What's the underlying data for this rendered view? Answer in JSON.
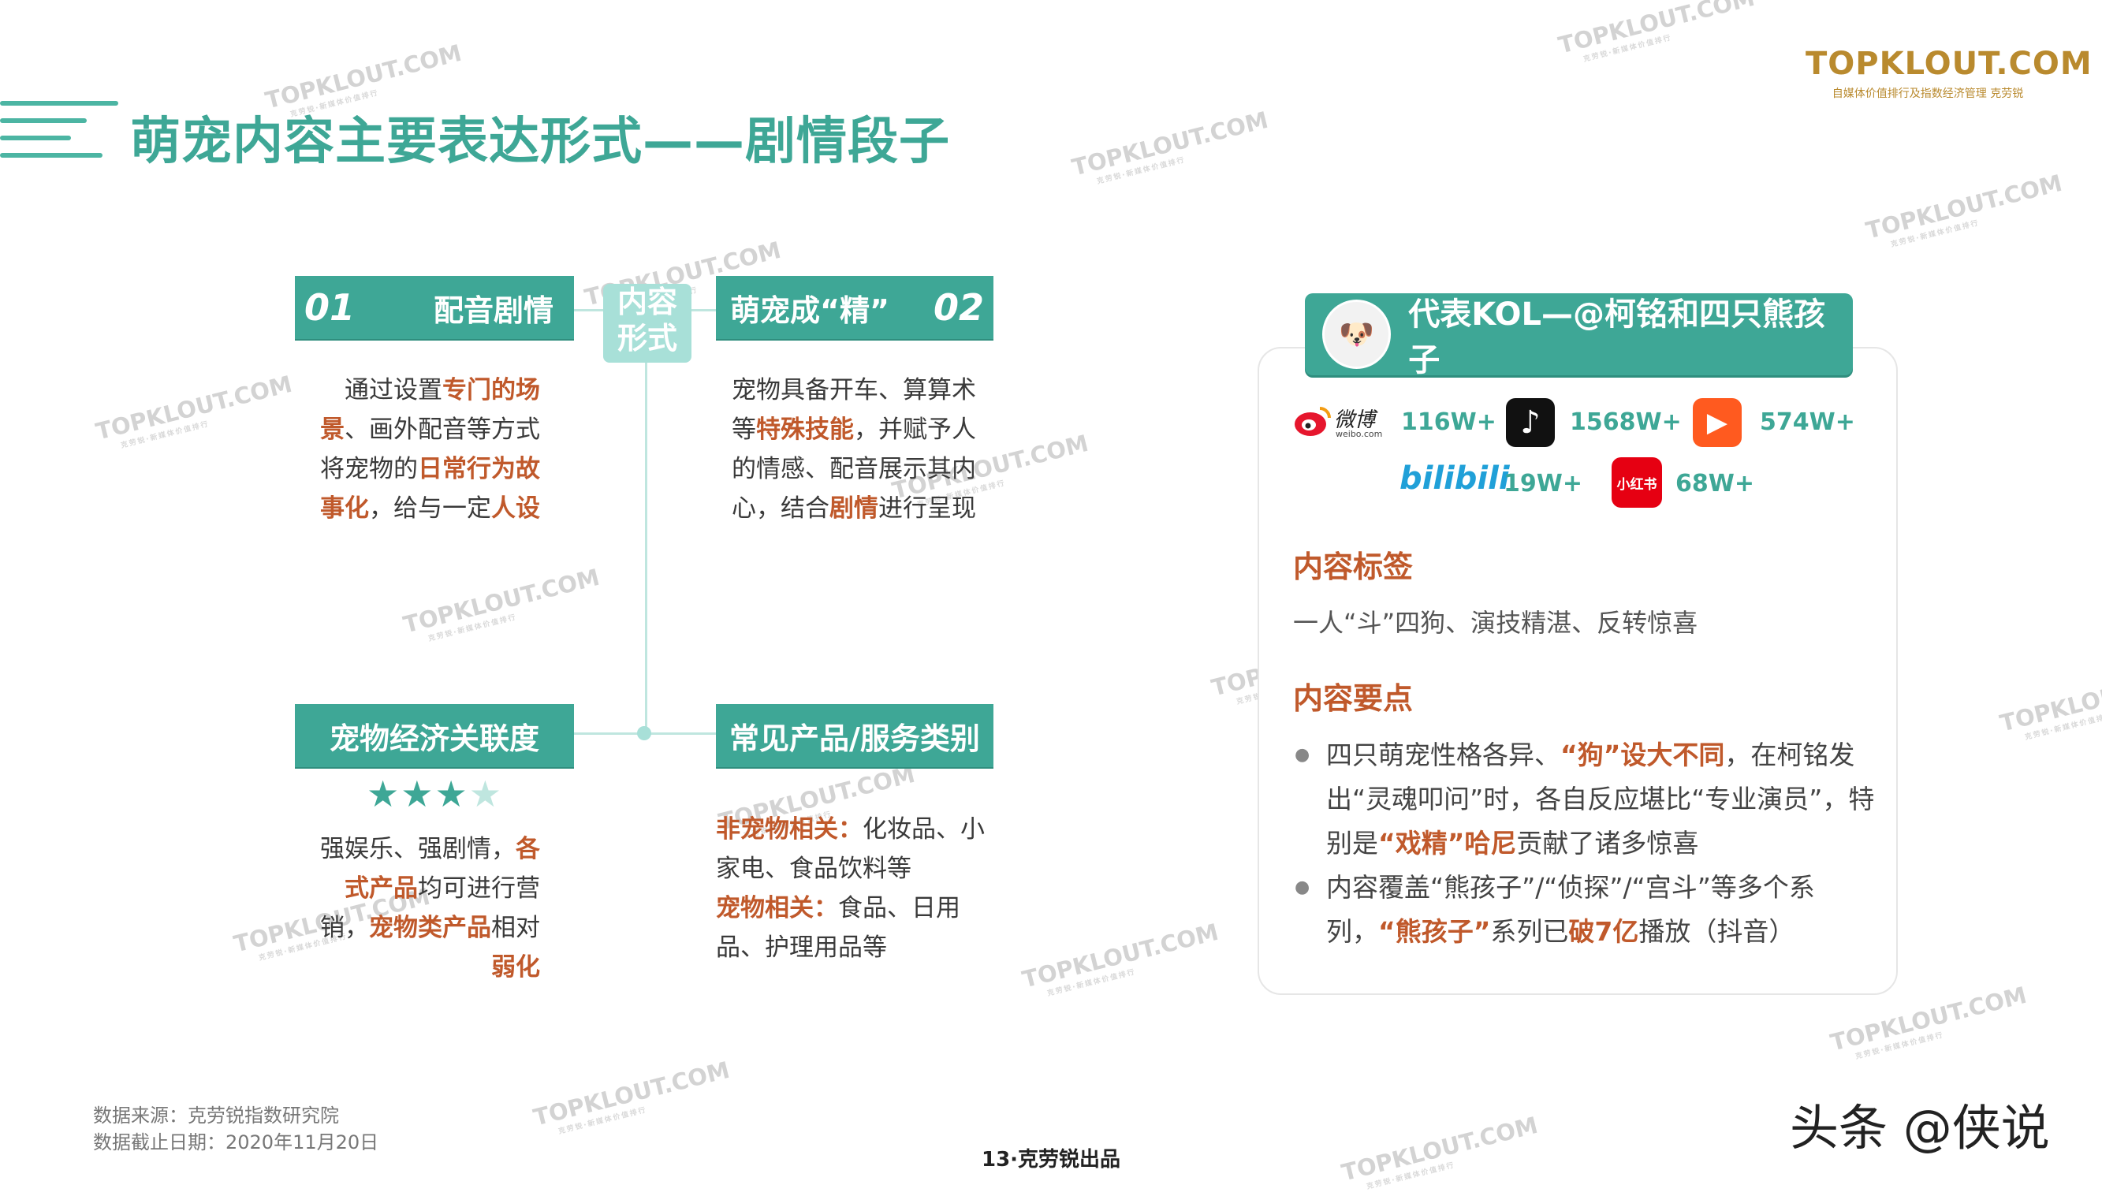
{
  "header": {
    "title": "萌宠内容主要表达形式——剧情段子",
    "brand_main": "TOPKLOUT.COM",
    "brand_sub": "自媒体价值排行及指数经济管理 克劳锐"
  },
  "watermark": {
    "text": "TOPKLOUT.COM",
    "sub": "克劳锐·新媒体价值排行"
  },
  "center": {
    "label": "内容形式"
  },
  "sections": {
    "s01": {
      "num": "01",
      "title": "配音剧情",
      "segments": [
        "通过设置",
        "专门的场景",
        "、画外配音等方式将宠物的",
        "日常行为故事化",
        "，给与一定",
        "人设"
      ]
    },
    "s02": {
      "num": "02",
      "title": "萌宠成“精”",
      "segments": [
        "宠物具备开车、算算术等",
        "特殊技能",
        "，并赋予人的情感、配音展示其内心，结合",
        "剧情",
        "进行呈现"
      ]
    },
    "s03": {
      "title": "宠物经济关联度",
      "rating": 3.5,
      "rating_max": 4,
      "segments": [
        "强娱乐、强剧情，",
        "各式产品",
        "均可进行营销，",
        "宠物类产品",
        "相对",
        "弱化"
      ]
    },
    "s04": {
      "title": "常见产品/服务类别",
      "line1_label": "非宠物相关：",
      "line1_text": "化妆品、小家电、食品饮料等",
      "line2_label": "宠物相关：",
      "line2_text": "食品、日用品、护理用品等"
    }
  },
  "kol": {
    "header": "代表KOL—@柯铭和四只熊孩子",
    "platforms": [
      {
        "name": "微博",
        "icon": "weibo-icon",
        "value": "116W+"
      },
      {
        "name": "抖音",
        "icon": "douyin-icon",
        "value": "1568W+"
      },
      {
        "name": "快手",
        "icon": "kuaishou-icon",
        "value": "574W+"
      },
      {
        "name": "bilibili",
        "icon": "bilibili-icon",
        "value": "19W+"
      },
      {
        "name": "小红书",
        "icon": "xiaohongshu-icon",
        "value": "68W+"
      }
    ],
    "weibo_sub": "weibo.com",
    "tags_title": "内容标签",
    "tags_text": "一人“斗”四狗、演技精湛、反转惊喜",
    "points_title": "内容要点",
    "point1": [
      "四只萌宠性格各异、",
      "“狗”设大不同",
      "，在柯铭发出“灵魂叩问”时，各自反应堪比“专业演员”，特别是",
      "“戏精”哈尼",
      "贡献了诸多惊喜"
    ],
    "point2": [
      "内容覆盖“熊孩子”/“侦探”/“宫斗”等多个系列，",
      "“熊孩子”",
      "系列已",
      "破7亿",
      "播放（抖音）"
    ]
  },
  "footer": {
    "source": "数据来源：克劳锐指数研究院",
    "date": "数据截止日期：2020年11月20日",
    "page": "13·克劳锐出品",
    "toutiao": "头条 @侠说"
  },
  "colors": {
    "teal": "#3ea796",
    "light_teal": "#a8e0d8",
    "accent": "#c0592b",
    "brand": "#b98a2e"
  }
}
